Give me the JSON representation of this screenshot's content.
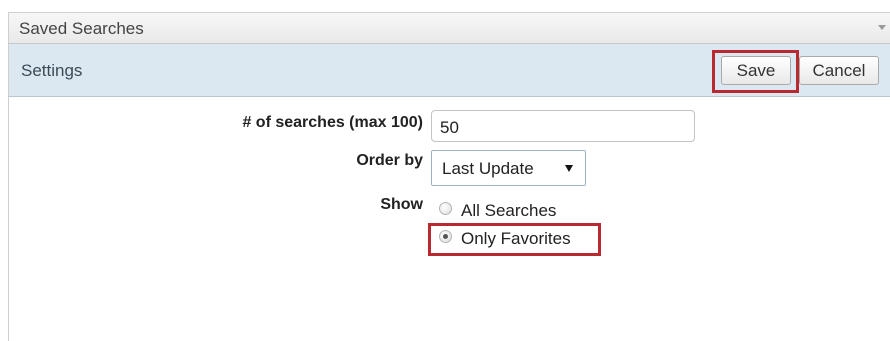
{
  "panel": {
    "title": "Saved Searches"
  },
  "settings": {
    "label": "Settings",
    "save_label": "Save",
    "cancel_label": "Cancel"
  },
  "form": {
    "count_label": "# of searches (max 100)",
    "count_value": "50",
    "order_label": "Order by",
    "order_value": "Last Update",
    "show_label": "Show",
    "show_options": [
      {
        "label": "All Searches",
        "checked": false
      },
      {
        "label": "Only Favorites",
        "checked": true
      }
    ]
  },
  "colors": {
    "highlight": "#b82a2f",
    "settings_bar": "#dbe8f1"
  },
  "icons": {
    "panel_menu": "chevron-down-icon",
    "select_arrow": "triangle-down-icon"
  }
}
